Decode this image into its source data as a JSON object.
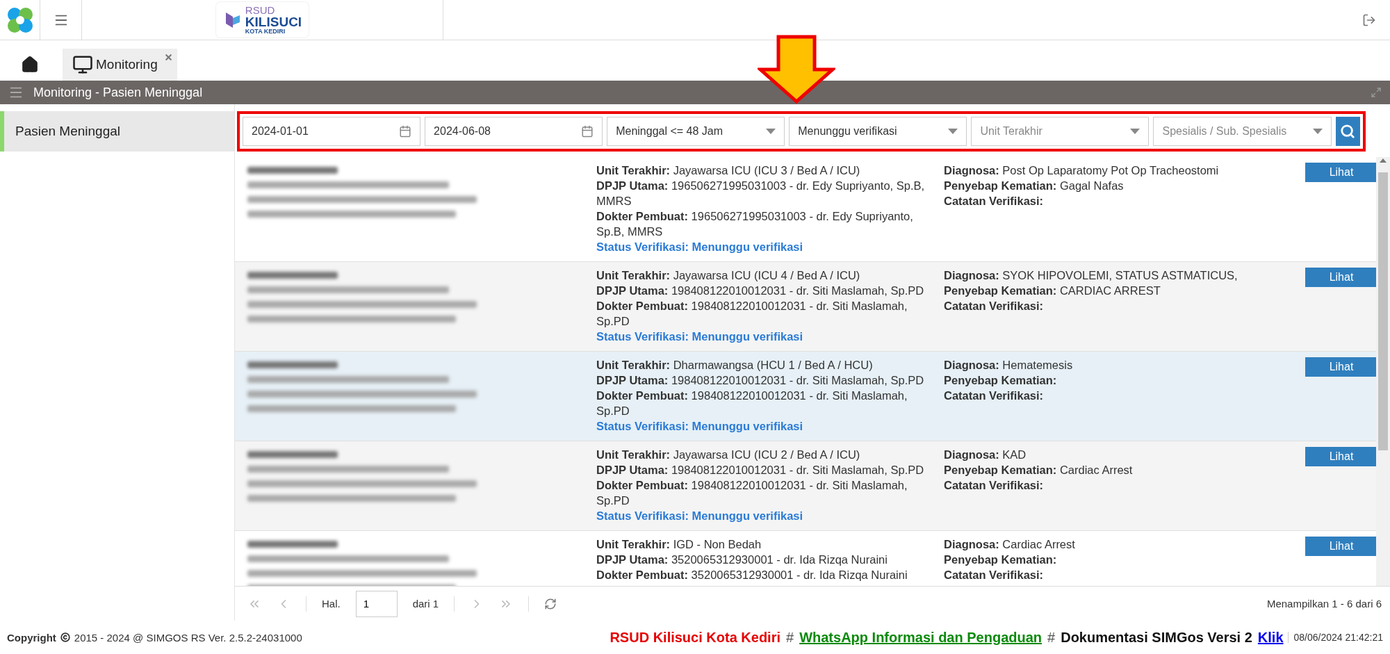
{
  "header": {
    "logo": {
      "top": "RSUD",
      "name": "KILISUCI",
      "sub": "KOTA KEDIRI"
    }
  },
  "tabs": [
    {
      "kind": "home",
      "selected": false
    },
    {
      "kind": "page",
      "label": "Monitoring",
      "selected": true
    }
  ],
  "panel": {
    "title": "Monitoring - Pasien Meninggal"
  },
  "sidebar": {
    "items": [
      {
        "label": "Pasien Meninggal",
        "selected": true
      }
    ]
  },
  "filters": [
    {
      "kind": "date",
      "value": "2024-01-01"
    },
    {
      "kind": "date",
      "value": "2024-06-08"
    },
    {
      "kind": "select",
      "value": "Meninggal <= 48 Jam"
    },
    {
      "kind": "select",
      "value": "Menunggu verifikasi"
    },
    {
      "kind": "select",
      "placeholder": "Unit Terakhir"
    },
    {
      "kind": "select",
      "placeholder": "Spesialis / Sub. Spesialis"
    }
  ],
  "rows": [
    {
      "selected": false,
      "middle": [
        {
          "label": "Unit Terakhir:",
          "value": "Jayawarsa ICU (ICU 3 / Bed A / ICU)"
        },
        {
          "label": "DPJP Utama:",
          "value": "196506271995031003 - dr. Edy Supriyanto, Sp.B, MMRS"
        },
        {
          "label": "Dokter Pembuat:",
          "value": "196506271995031003 - dr. Edy Supriyanto, Sp.B, MMRS"
        }
      ],
      "status": {
        "label": "Status Verifikasi:",
        "value": "Menunggu verifikasi"
      },
      "right": [
        {
          "label": "Diagnosa:",
          "value": "Post Op Laparatomy Pot Op Tracheostomi"
        },
        {
          "label": "Penyebap Kematian:",
          "value": "Gagal Nafas"
        },
        {
          "label": "Catatan Verifikasi:"
        }
      ],
      "button": "Lihat"
    },
    {
      "selected": false,
      "middle": [
        {
          "label": "Unit Terakhir:",
          "value": "Jayawarsa ICU (ICU 4 / Bed A / ICU)"
        },
        {
          "label": "DPJP Utama:",
          "value": "198408122010012031 - dr. Siti Maslamah, Sp.PD"
        },
        {
          "label": "Dokter Pembuat:",
          "value": "198408122010012031 - dr. Siti Maslamah, Sp.PD"
        }
      ],
      "status": {
        "label": "Status Verifikasi:",
        "value": "Menunggu verifikasi"
      },
      "right": [
        {
          "label": "Diagnosa:",
          "value": "SYOK HIPOVOLEMI, STATUS ASTMATICUS,"
        },
        {
          "label": "Penyebap Kematian:",
          "value": "CARDIAC ARREST"
        },
        {
          "label": "Catatan Verifikasi:"
        }
      ],
      "button": "Lihat"
    },
    {
      "selected": true,
      "middle": [
        {
          "label": "Unit Terakhir:",
          "value": "Dharmawangsa (HCU 1 / Bed A / HCU)"
        },
        {
          "label": "DPJP Utama:",
          "value": "198408122010012031 - dr. Siti Maslamah, Sp.PD"
        },
        {
          "label": "Dokter Pembuat:",
          "value": "198408122010012031 - dr. Siti Maslamah, Sp.PD"
        }
      ],
      "status": {
        "label": "Status Verifikasi:",
        "value": "Menunggu verifikasi"
      },
      "right": [
        {
          "label": "Diagnosa:",
          "value": "Hematemesis"
        },
        {
          "label": "Penyebap Kematian:"
        },
        {
          "label": "Catatan Verifikasi:"
        }
      ],
      "button": "Lihat"
    },
    {
      "selected": false,
      "middle": [
        {
          "label": "Unit Terakhir:",
          "value": "Jayawarsa ICU (ICU 2 / Bed A / ICU)"
        },
        {
          "label": "DPJP Utama:",
          "value": "198408122010012031 - dr. Siti Maslamah, Sp.PD"
        },
        {
          "label": "Dokter Pembuat:",
          "value": "198408122010012031 - dr. Siti Maslamah, Sp.PD"
        }
      ],
      "status": {
        "label": "Status Verifikasi:",
        "value": "Menunggu verifikasi"
      },
      "right": [
        {
          "label": "Diagnosa:",
          "value": "KAD"
        },
        {
          "label": "Penyebap Kematian:",
          "value": "Cardiac Arrest"
        },
        {
          "label": "Catatan Verifikasi:"
        }
      ],
      "button": "Lihat"
    },
    {
      "selected": false,
      "middle": [
        {
          "label": "Unit Terakhir:",
          "value": "IGD - Non Bedah"
        },
        {
          "label": "DPJP Utama:",
          "value": "3520065312930001 - dr. Ida Rizqa Nuraini"
        },
        {
          "label": "Dokter Pembuat:",
          "value": "3520065312930001 - dr. Ida Rizqa Nuraini"
        }
      ],
      "right": [
        {
          "label": "Diagnosa:",
          "value": "Cardiac Arrest"
        },
        {
          "label": "Penyebap Kematian:"
        },
        {
          "label": "Catatan Verifikasi:"
        }
      ],
      "button": "Lihat"
    }
  ],
  "pager": {
    "page_label": "Hal.",
    "page": "1",
    "of": "dari 1",
    "summary": "Menampilkan 1 - 6 dari 6"
  },
  "footer": {
    "copyright_label": "Copyright",
    "copyright_text": "2015 - 2024 @ SIMGOS RS Ver. 2.5.2-24031000",
    "ticker": [
      {
        "kind": "red",
        "text": "RSUD Kilisuci Kota Kediri"
      },
      {
        "kind": "sep",
        "text": "#"
      },
      {
        "kind": "link-green",
        "text": "WhatsApp Informasi dan Pengaduan"
      },
      {
        "kind": "sep",
        "text": "#"
      },
      {
        "kind": "plain",
        "text": "Dokumentasi SIMGos Versi 2"
      },
      {
        "kind": "link-blue",
        "text": "Klik"
      }
    ],
    "datetime": "08/06/2024 21:42:21"
  }
}
